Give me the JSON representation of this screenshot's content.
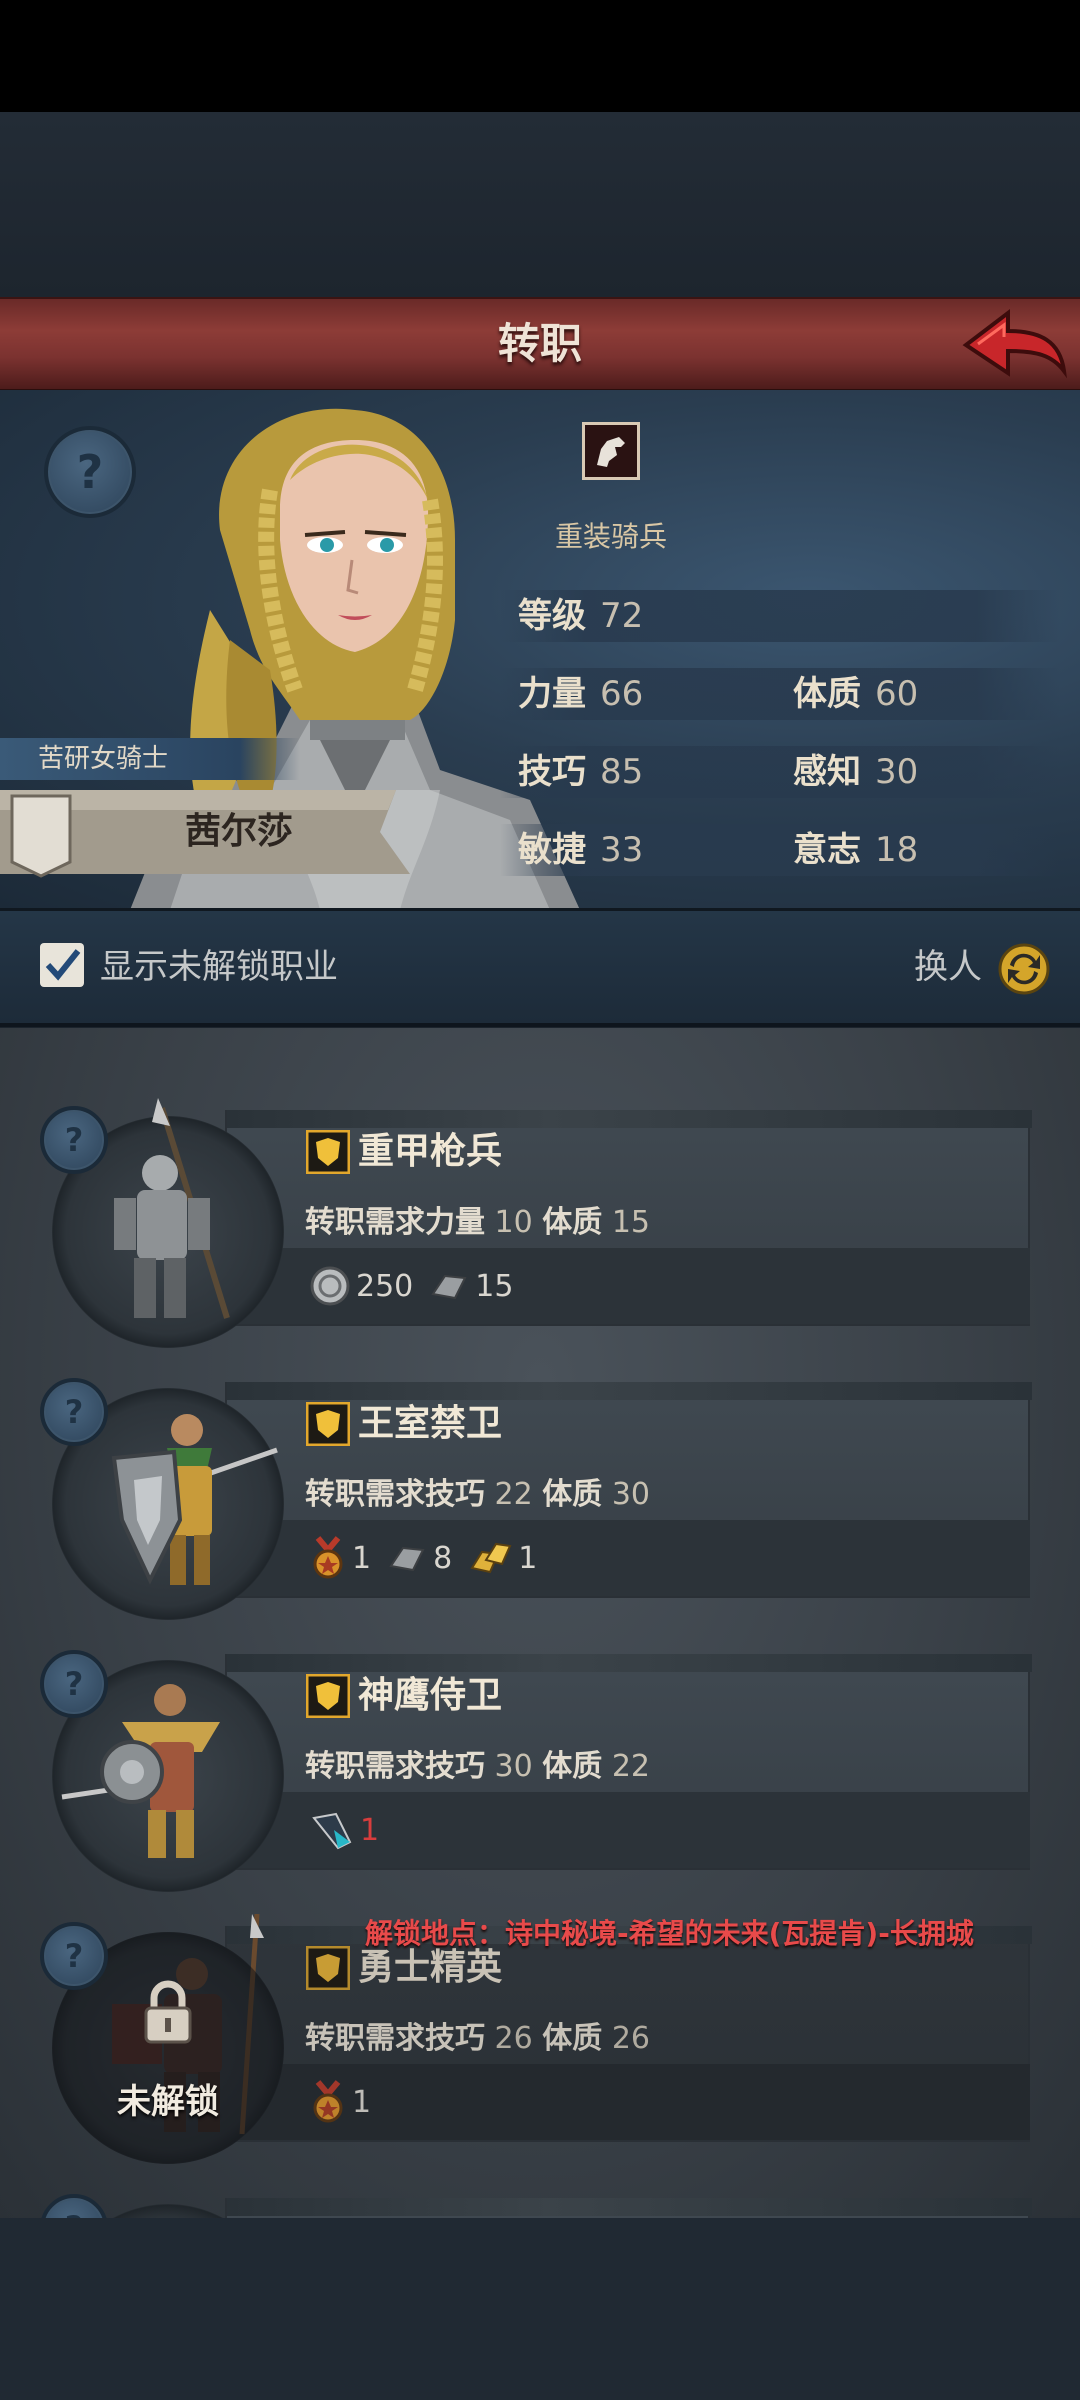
{
  "header": {
    "title": "转职"
  },
  "character": {
    "class_name": "重装骑兵",
    "title": "苦研女骑士",
    "name": "茜尔莎",
    "stats": {
      "level": {
        "label": "等级",
        "value": "72"
      },
      "strength": {
        "label": "力量",
        "value": "66"
      },
      "constitution": {
        "label": "体质",
        "value": "60"
      },
      "skill": {
        "label": "技巧",
        "value": "85"
      },
      "perception": {
        "label": "感知",
        "value": "30"
      },
      "agility": {
        "label": "敏捷",
        "value": "33"
      },
      "will": {
        "label": "意志",
        "value": "18"
      }
    }
  },
  "filter": {
    "show_locked_label": "显示未解锁职业",
    "show_locked_checked": true,
    "swap_label": "换人"
  },
  "jobs": [
    {
      "name": "重甲枪兵",
      "req_prefix": "转职需求",
      "req1_label": "力量",
      "req1_value": "10",
      "req2_label": "体质",
      "req2_value": "15",
      "cost1": "250",
      "cost2": "15"
    },
    {
      "name": "王室禁卫",
      "req_prefix": "转职需求",
      "req1_label": "技巧",
      "req1_value": "22",
      "req2_label": "体质",
      "req2_value": "30",
      "cost1": "1",
      "cost2": "8",
      "cost3": "1"
    },
    {
      "name": "神鹰侍卫",
      "req_prefix": "转职需求",
      "req1_label": "技巧",
      "req1_value": "30",
      "req2_label": "体质",
      "req2_value": "22",
      "cost1": "1"
    },
    {
      "name": "勇士精英",
      "req_prefix": "转职需求",
      "req1_label": "技巧",
      "req1_value": "26",
      "req2_label": "体质",
      "req2_value": "26",
      "cost1": "1",
      "locked_label": "未解锁",
      "unlock_hint": "解锁地点：诗中秘境-希望的未来(瓦提肯)-长拥城"
    }
  ],
  "colors": {
    "title_banner": "#8d3c37",
    "unlock_hint": "#e84a4a",
    "shortage_red": "#d83d3d"
  }
}
